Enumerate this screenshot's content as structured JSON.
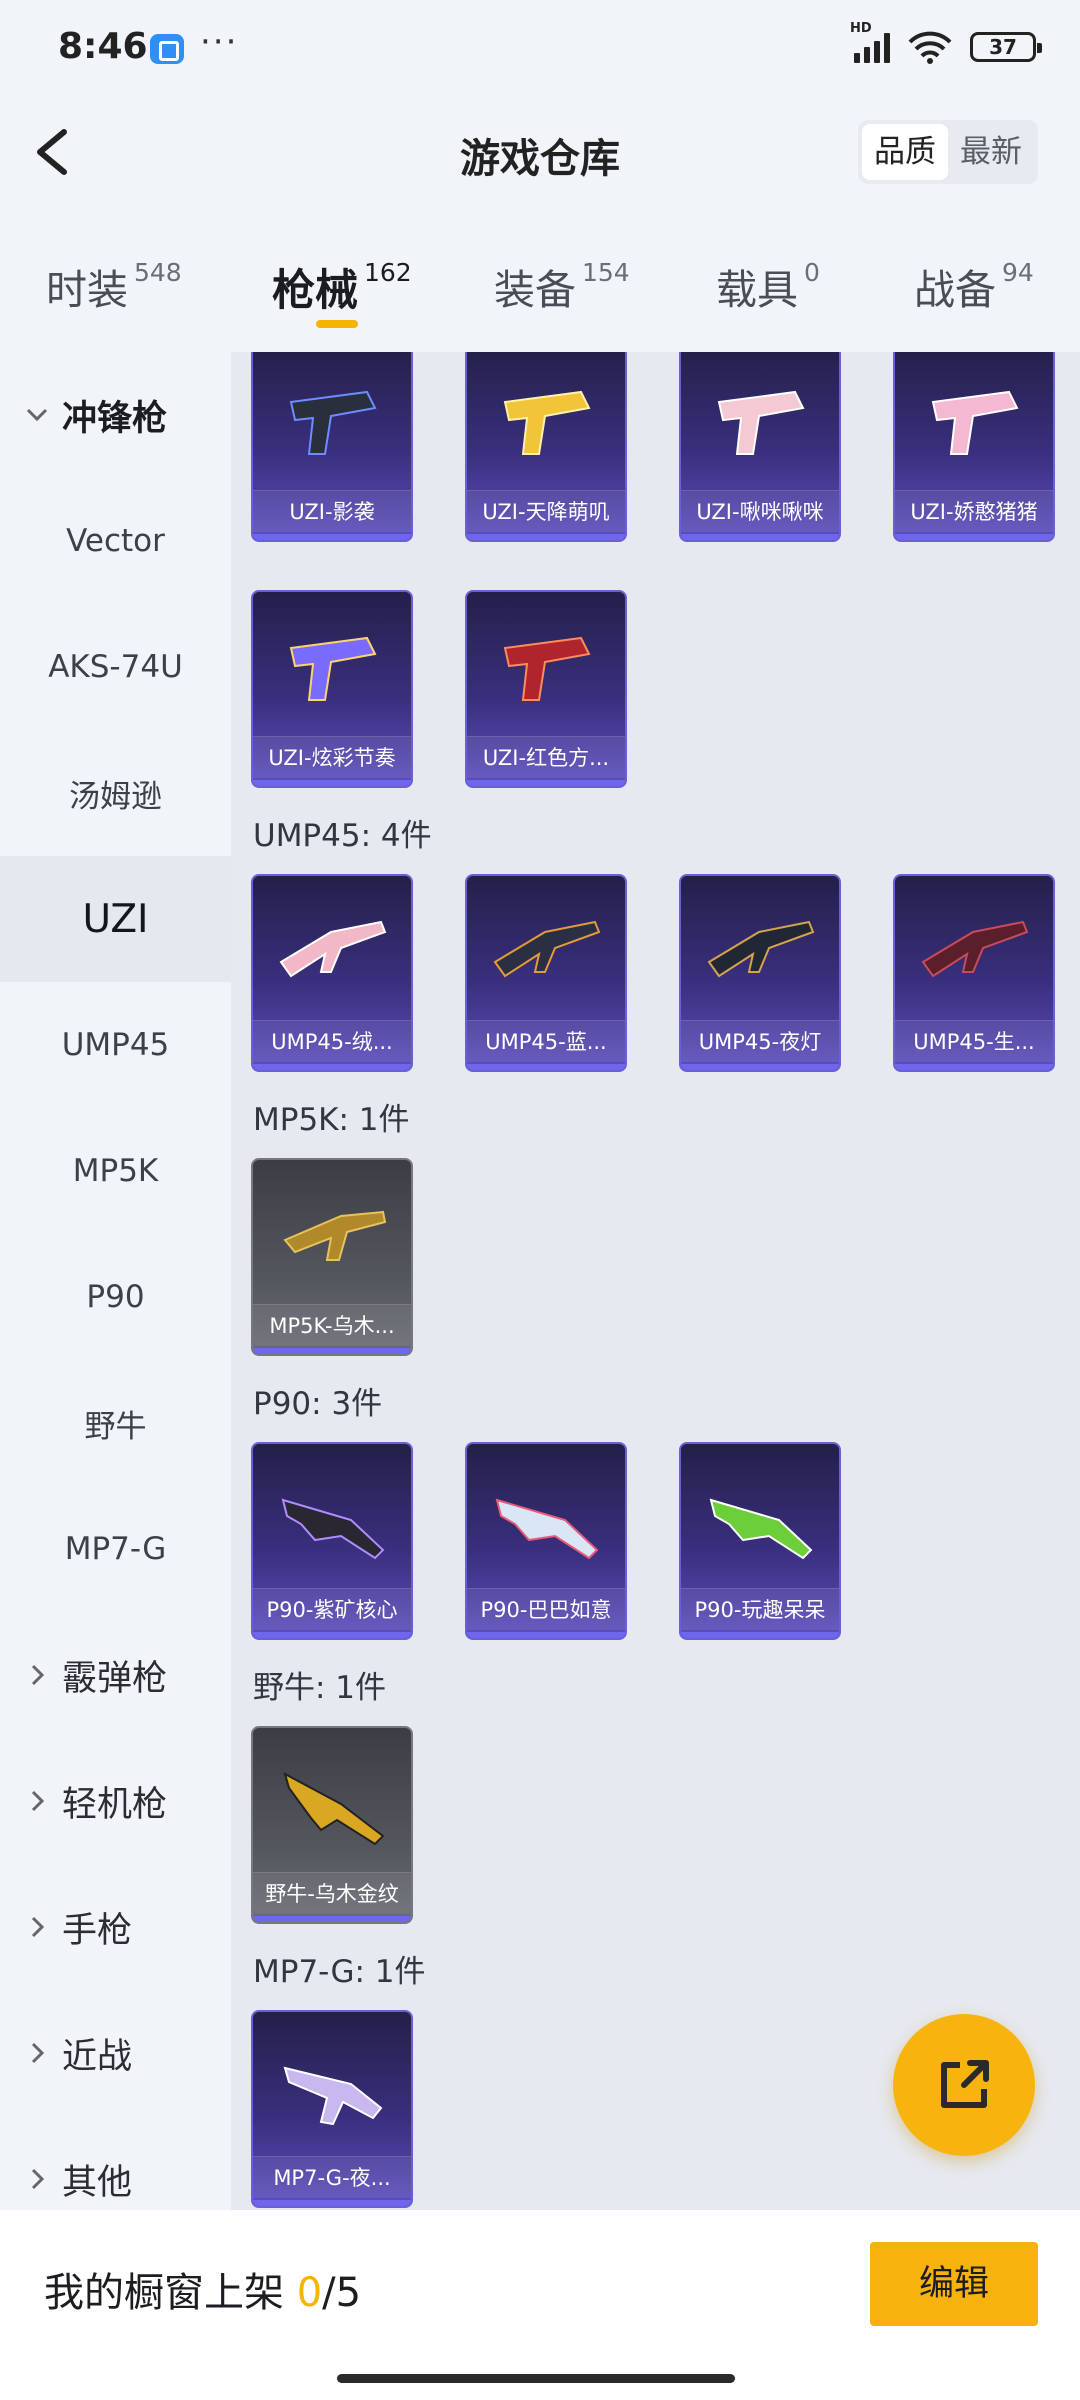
{
  "status_bar": {
    "time": "8:46",
    "more": "···",
    "network": "HD",
    "battery": "37"
  },
  "header": {
    "title": "游戏仓库",
    "sort_options": [
      "品质",
      "最新"
    ],
    "active_sort": "品质"
  },
  "tabs": [
    {
      "label": "时装",
      "count": "548"
    },
    {
      "label": "枪械",
      "count": "162"
    },
    {
      "label": "装备",
      "count": "154"
    },
    {
      "label": "载具",
      "count": "0"
    },
    {
      "label": "战备",
      "count": "94"
    }
  ],
  "active_tab": "枪械",
  "sidebar": {
    "items": [
      {
        "label": "冲锋枪",
        "type": "group-open"
      },
      {
        "label": "Vector"
      },
      {
        "label": "AKS-74U"
      },
      {
        "label": "汤姆逊"
      },
      {
        "label": "UZI",
        "active": true
      },
      {
        "label": "UMP45"
      },
      {
        "label": "MP5K"
      },
      {
        "label": "P90"
      },
      {
        "label": "野牛"
      },
      {
        "label": "MP7-G"
      },
      {
        "label": "霰弹枪",
        "type": "group"
      },
      {
        "label": "轻机枪",
        "type": "group"
      },
      {
        "label": "手枪",
        "type": "group"
      },
      {
        "label": "近战",
        "type": "group"
      },
      {
        "label": "其他",
        "type": "group"
      }
    ]
  },
  "sections": {
    "uzi": {
      "items": [
        "UZI-影袭",
        "UZI-天降萌叽",
        "UZI-啾咪啾咪",
        "UZI-娇憨猪猪",
        "UZI-炫彩节奏",
        "UZI-红色方..."
      ]
    },
    "ump45": {
      "title": "UMP45: 4件",
      "items": [
        "UMP45-绒...",
        "UMP45-蓝...",
        "UMP45-夜灯",
        "UMP45-生..."
      ]
    },
    "mp5k": {
      "title": "MP5K: 1件",
      "items": [
        "MP5K-乌木..."
      ]
    },
    "p90": {
      "title": "P90: 3件",
      "items": [
        "P90-紫矿核心",
        "P90-巴巴如意",
        "P90-玩趣呆呆"
      ]
    },
    "bison": {
      "title": "野牛: 1件",
      "items": [
        "野牛-乌木金纹"
      ]
    },
    "mp7g": {
      "title": "MP7-G: 1件",
      "items": [
        "MP7-G-夜..."
      ]
    }
  },
  "bottom_bar": {
    "showcase_label": "我的橱窗上架",
    "showcase_count": "0",
    "showcase_total": "/5",
    "edit_label": "编辑"
  },
  "icons": {
    "back": "back-arrow-icon",
    "share": "share-icon",
    "chevron_down": "chevron-down-icon",
    "chevron_right": "chevron-right-icon"
  },
  "colors": {
    "accent": "#F5B400",
    "card_purple": "#3A2F7E",
    "card_grey": "#54565E"
  }
}
